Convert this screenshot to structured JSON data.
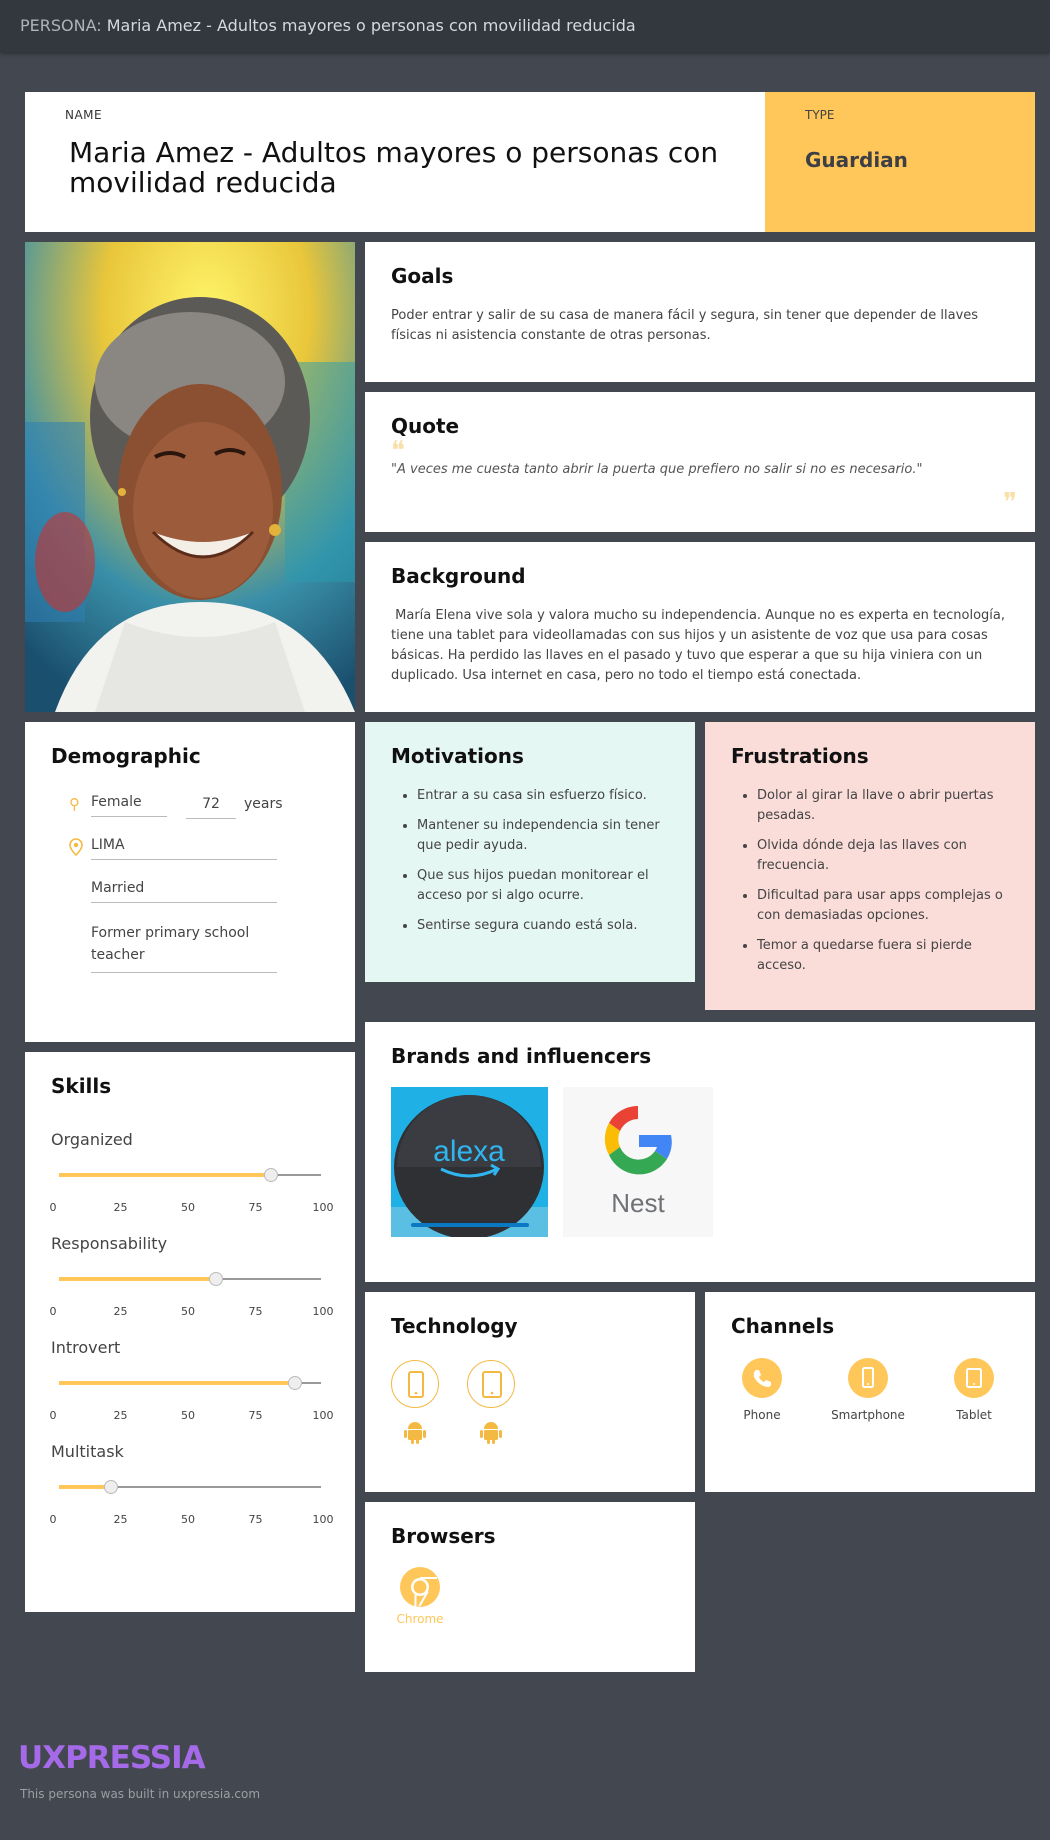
{
  "header": {
    "prefix": "PERSONA:",
    "title": "Maria Amez - Adultos mayores  o personas con movilidad reducida"
  },
  "persona": {
    "name_label": "NAME",
    "name": "Maria Amez - Adultos mayores  o personas con movilidad reducida",
    "type_label": "TYPE",
    "type": "Guardian"
  },
  "goals": {
    "title": "Goals",
    "text": "Poder entrar y salir de su casa de manera fácil y segura, sin tener que depender de llaves físicas ni asistencia constante de otras personas."
  },
  "quote": {
    "title": "Quote",
    "text": "\"A veces me cuesta tanto abrir la puerta que prefiero no salir si no es necesario.\""
  },
  "background": {
    "title": "Background",
    "text": " María Elena vive sola y valora mucho su independencia. Aunque no es experta en tecnología, tiene una tablet para videollamadas con sus hijos y un asistente de voz que usa para cosas básicas. Ha perdido las llaves en el pasado y tuvo que esperar a que su hija viniera con un duplicado. Usa internet en casa, pero no todo el tiempo está conectada."
  },
  "demographic": {
    "title": "Demographic",
    "gender": "Female",
    "age": "72",
    "age_unit": "years",
    "location": "LIMA",
    "status": "Married",
    "occupation": "Former primary school teacher"
  },
  "motivations": {
    "title": "Motivations",
    "items": [
      "Entrar a su casa sin esfuerzo físico.",
      "Mantener su independencia sin tener que pedir ayuda.",
      "Que sus hijos puedan monitorear el acceso por si algo ocurre.",
      "Sentirse segura cuando está sola."
    ]
  },
  "frustrations": {
    "title": "Frustrations",
    "items": [
      "Dolor al girar la llave o abrir puertas pesadas.",
      "Olvida dónde deja las llaves con frecuencia.",
      "Dificultad para usar apps complejas o con demasiadas opciones.",
      "Temor a quedarse fuera si pierde acceso."
    ]
  },
  "skills": {
    "title": "Skills",
    "ticks": [
      "0",
      "25",
      "50",
      "75",
      "100"
    ],
    "items": [
      {
        "name": "Organized",
        "value": 81
      },
      {
        "name": "Responsability",
        "value": 60
      },
      {
        "name": "Introvert",
        "value": 90
      },
      {
        "name": "Multitask",
        "value": 20
      }
    ]
  },
  "brands": {
    "title": "Brands and influencers",
    "items": [
      {
        "name": "alexa"
      },
      {
        "name": "Nest"
      }
    ]
  },
  "technology": {
    "title": "Technology",
    "devices": [
      "smartphone-icon",
      "tablet-icon"
    ],
    "os": [
      "android-icon",
      "android-icon"
    ]
  },
  "channels": {
    "title": "Channels",
    "items": [
      {
        "label": "Phone",
        "icon": "phone-icon"
      },
      {
        "label": "Smartphone",
        "icon": "smartphone-icon"
      },
      {
        "label": "Tablet",
        "icon": "tablet-icon"
      }
    ]
  },
  "browsers": {
    "title": "Browsers",
    "items": [
      {
        "label": "Chrome",
        "icon": "chrome-icon"
      }
    ]
  },
  "footer": {
    "logo": "UXPRESSIA",
    "note": "This persona was built in uxpressia.com"
  },
  "colors": {
    "accent": "#ffc659",
    "motivations_bg": "#e5f7f2",
    "frustrations_bg": "#fadcd9",
    "logo": "#a56ae8"
  }
}
